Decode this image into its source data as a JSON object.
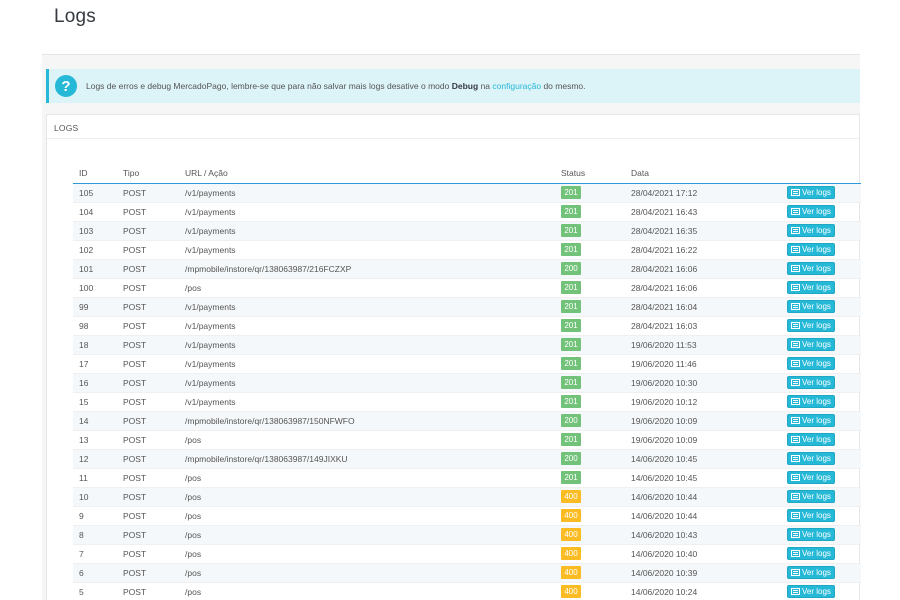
{
  "page": {
    "title": "Logs"
  },
  "alert": {
    "text_before": "Logs de erros e debug MercadoPago, lembre-se que para não salvar mais logs desative o modo",
    "bold": "Debug",
    "text_middle": "na",
    "link": "configuração",
    "text_after": "do mesmo."
  },
  "panel": {
    "title": "LOGS"
  },
  "table": {
    "headers": {
      "id": "ID",
      "tipo": "Tipo",
      "url": "URL / Ação",
      "status": "Status",
      "data": "Data"
    },
    "button_label": "Ver logs",
    "rows": [
      {
        "id": "105",
        "tipo": "POST",
        "url": "/v1/payments",
        "status": "201",
        "status_type": "ok",
        "data": "28/04/2021 17:12"
      },
      {
        "id": "104",
        "tipo": "POST",
        "url": "/v1/payments",
        "status": "201",
        "status_type": "ok",
        "data": "28/04/2021 16:43"
      },
      {
        "id": "103",
        "tipo": "POST",
        "url": "/v1/payments",
        "status": "201",
        "status_type": "ok",
        "data": "28/04/2021 16:35"
      },
      {
        "id": "102",
        "tipo": "POST",
        "url": "/v1/payments",
        "status": "201",
        "status_type": "ok",
        "data": "28/04/2021 16:22"
      },
      {
        "id": "101",
        "tipo": "POST",
        "url": "/mpmobile/instore/qr/138063987/216FCZXP",
        "status": "200",
        "status_type": "ok",
        "data": "28/04/2021 16:06"
      },
      {
        "id": "100",
        "tipo": "POST",
        "url": "/pos",
        "status": "201",
        "status_type": "ok",
        "data": "28/04/2021 16:06"
      },
      {
        "id": "99",
        "tipo": "POST",
        "url": "/v1/payments",
        "status": "201",
        "status_type": "ok",
        "data": "28/04/2021 16:04"
      },
      {
        "id": "98",
        "tipo": "POST",
        "url": "/v1/payments",
        "status": "201",
        "status_type": "ok",
        "data": "28/04/2021 16:03"
      },
      {
        "id": "18",
        "tipo": "POST",
        "url": "/v1/payments",
        "status": "201",
        "status_type": "ok",
        "data": "19/06/2020 11:53"
      },
      {
        "id": "17",
        "tipo": "POST",
        "url": "/v1/payments",
        "status": "201",
        "status_type": "ok",
        "data": "19/06/2020 11:46"
      },
      {
        "id": "16",
        "tipo": "POST",
        "url": "/v1/payments",
        "status": "201",
        "status_type": "ok",
        "data": "19/06/2020 10:30"
      },
      {
        "id": "15",
        "tipo": "POST",
        "url": "/v1/payments",
        "status": "201",
        "status_type": "ok",
        "data": "19/06/2020 10:12"
      },
      {
        "id": "14",
        "tipo": "POST",
        "url": "/mpmobile/instore/qr/138063987/150NFWFO",
        "status": "200",
        "status_type": "ok",
        "data": "19/06/2020 10:09"
      },
      {
        "id": "13",
        "tipo": "POST",
        "url": "/pos",
        "status": "201",
        "status_type": "ok",
        "data": "19/06/2020 10:09"
      },
      {
        "id": "12",
        "tipo": "POST",
        "url": "/mpmobile/instore/qr/138063987/149JIXKU",
        "status": "200",
        "status_type": "ok",
        "data": "14/06/2020 10:45"
      },
      {
        "id": "11",
        "tipo": "POST",
        "url": "/pos",
        "status": "201",
        "status_type": "ok",
        "data": "14/06/2020 10:45"
      },
      {
        "id": "10",
        "tipo": "POST",
        "url": "/pos",
        "status": "400",
        "status_type": "warn",
        "data": "14/06/2020 10:44"
      },
      {
        "id": "9",
        "tipo": "POST",
        "url": "/pos",
        "status": "400",
        "status_type": "warn",
        "data": "14/06/2020 10:44"
      },
      {
        "id": "8",
        "tipo": "POST",
        "url": "/pos",
        "status": "400",
        "status_type": "warn",
        "data": "14/06/2020 10:43"
      },
      {
        "id": "7",
        "tipo": "POST",
        "url": "/pos",
        "status": "400",
        "status_type": "warn",
        "data": "14/06/2020 10:40"
      },
      {
        "id": "6",
        "tipo": "POST",
        "url": "/pos",
        "status": "400",
        "status_type": "warn",
        "data": "14/06/2020 10:39"
      },
      {
        "id": "5",
        "tipo": "POST",
        "url": "/pos",
        "status": "400",
        "status_type": "warn",
        "data": "14/06/2020 10:24"
      }
    ]
  }
}
